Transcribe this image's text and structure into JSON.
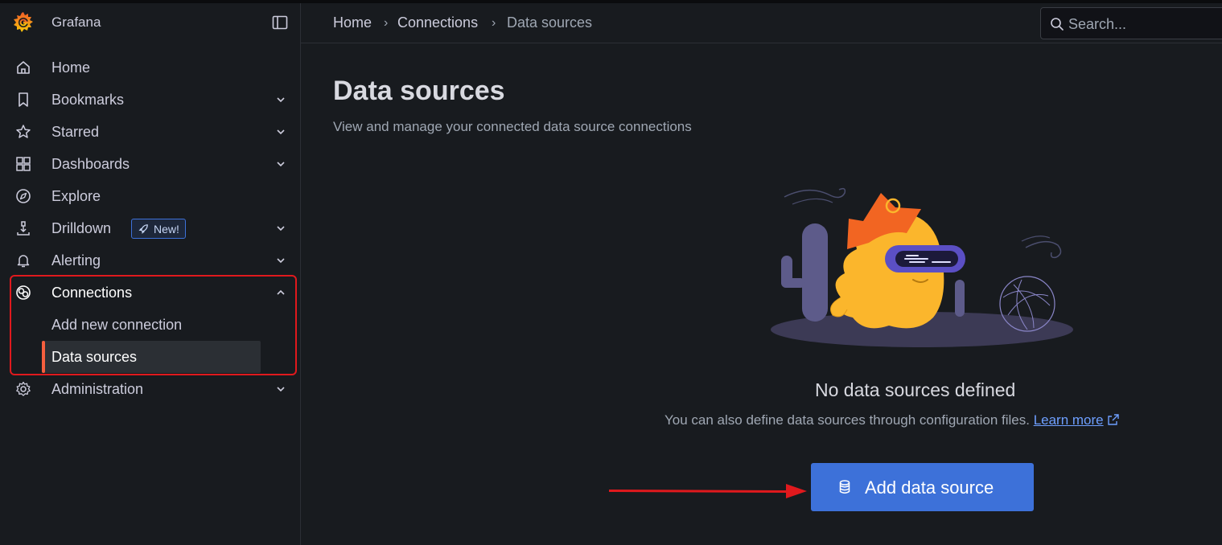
{
  "app": {
    "name": "Grafana"
  },
  "sidebar": {
    "items": [
      {
        "label": "Home",
        "icon": "home-icon",
        "expandable": false
      },
      {
        "label": "Bookmarks",
        "icon": "bookmark-icon",
        "expandable": true
      },
      {
        "label": "Starred",
        "icon": "star-icon",
        "expandable": true
      },
      {
        "label": "Dashboards",
        "icon": "apps-icon",
        "expandable": true
      },
      {
        "label": "Explore",
        "icon": "compass-icon",
        "expandable": false
      },
      {
        "label": "Drilldown",
        "icon": "drilldown-icon",
        "expandable": true,
        "badge": "New!"
      },
      {
        "label": "Alerting",
        "icon": "bell-icon",
        "expandable": true
      },
      {
        "label": "Connections",
        "icon": "connections-icon",
        "expandable": true,
        "expanded": true,
        "children": [
          {
            "label": "Add new connection"
          },
          {
            "label": "Data sources",
            "selected": true
          }
        ]
      },
      {
        "label": "Administration",
        "icon": "cog-icon",
        "expandable": true
      }
    ]
  },
  "breadcrumb": [
    "Home",
    "Connections",
    "Data sources"
  ],
  "search": {
    "placeholder": "Search..."
  },
  "page": {
    "title": "Data sources",
    "subtitle": "View and manage your connected data source connections"
  },
  "empty_state": {
    "title": "No data sources defined",
    "description": "You can also define data sources through configuration files.",
    "link": "Learn more"
  },
  "add_button": {
    "label": "Add data source",
    "icon": "database-icon"
  },
  "colors": {
    "background": "#181b1f",
    "primary": "#3d71d9",
    "accent": "#f55f3e",
    "annotation": "#e0191d",
    "link": "#6e9fff"
  }
}
